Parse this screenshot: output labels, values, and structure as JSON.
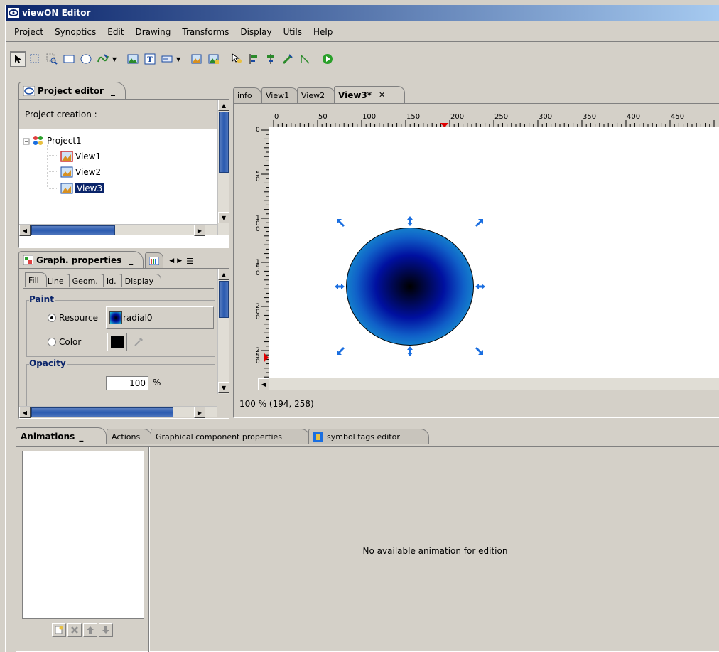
{
  "window": {
    "title": "viewON Editor"
  },
  "menu": [
    "Project",
    "Synoptics",
    "Edit",
    "Drawing",
    "Transforms",
    "Display",
    "Utils",
    "Help"
  ],
  "project_editor": {
    "tab_label": "Project editor",
    "minimize": "_",
    "creation_label": "Project creation :",
    "tree": {
      "root": "Project1",
      "views": [
        "View1",
        "View2",
        "View3"
      ],
      "selected": "View3"
    }
  },
  "graph_properties": {
    "tab_label": "Graph. properties",
    "minimize": "_",
    "subtabs": [
      "Fill",
      "Line",
      "Geom.",
      "Id.",
      "Display"
    ],
    "paint_group": "Paint",
    "resource_label": "Resource",
    "resource_value": "radial0",
    "color_label": "Color",
    "opacity_group": "Opacity",
    "opacity_value": "100",
    "opacity_unit": "%"
  },
  "editor": {
    "tabs": [
      "info",
      "View1",
      "View2",
      "View3*"
    ],
    "active_tab": "View3*",
    "close_glyph": "✕",
    "ruler_h_labels": [
      "0",
      "50",
      "100",
      "150",
      "200",
      "250",
      "300",
      "350",
      "400",
      "450"
    ],
    "ruler_v_labels": [
      "0",
      "5\n0",
      "1\n0\n0",
      "1\n5\n0",
      "2\n0\n0",
      "2\n5\n0"
    ],
    "status": "100 % (194, 258)"
  },
  "bottom": {
    "tabs": [
      "Animations",
      "Actions",
      "Graphical component properties",
      "symbol tags editor"
    ],
    "active_tab": "Animations",
    "minimize": "_",
    "empty_message": "No available animation for edition"
  },
  "colors": {
    "selection": "#0a246a",
    "gradient_center": "#000000",
    "gradient_mid": "#0010a0",
    "gradient_edge": "#20d0d8",
    "handle": "#1a6ee0"
  }
}
